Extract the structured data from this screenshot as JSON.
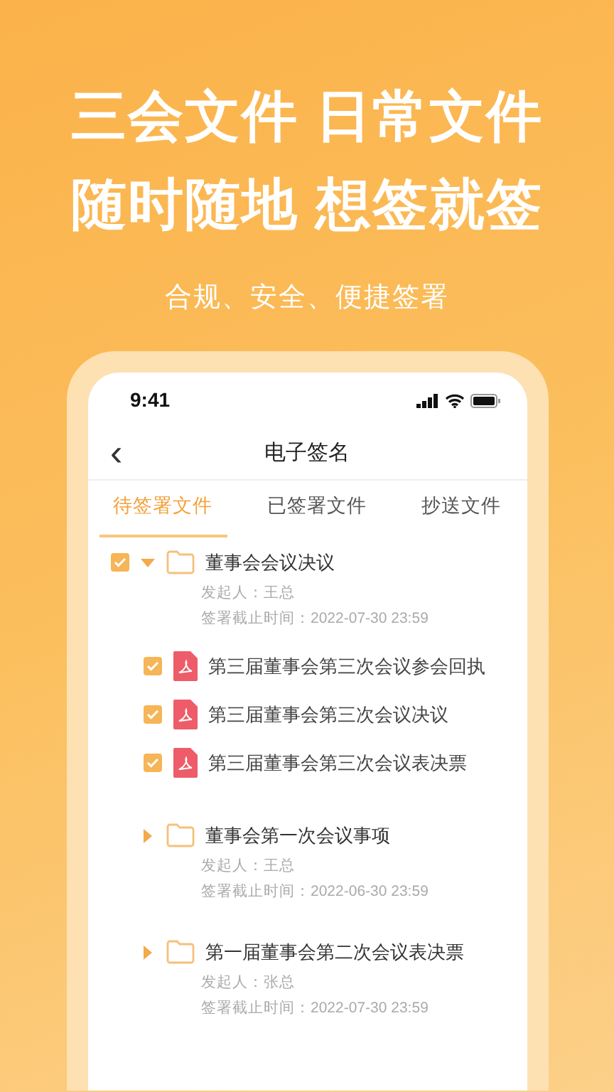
{
  "headline": [
    "三会文件 日常文件",
    "随时随地 想签就签"
  ],
  "subtitle": "合规、安全、便捷签署",
  "status_bar": {
    "time": "9:41"
  },
  "nav": {
    "back": "‹",
    "title": "电子签名"
  },
  "tabs": [
    {
      "label": "待签署文件",
      "selected": true
    },
    {
      "label": "已签署文件",
      "selected": false
    },
    {
      "label": "抄送文件",
      "selected": false
    }
  ],
  "folders": [
    {
      "title": "董事会会议决议",
      "checked": true,
      "expanded": true,
      "initiator": "发起人：王总",
      "deadline": "签署截止时间：2022-07-30 23:59",
      "files": [
        {
          "name": "第三届董事会第三次会议参会回执",
          "checked": true
        },
        {
          "name": "第三届董事会第三次会议决议",
          "checked": true
        },
        {
          "name": "第三届董事会第三次会议表决票",
          "checked": true
        }
      ]
    },
    {
      "title": "董事会第一次会议事项",
      "expanded": false,
      "initiator": "发起人：王总",
      "deadline": "签署截止时间：2022-06-30 23:59"
    },
    {
      "title": "第一届董事会第二次会议表决票",
      "expanded": false,
      "initiator": "发起人：张总",
      "deadline": "签署截止时间：2022-07-30 23:59"
    }
  ]
}
